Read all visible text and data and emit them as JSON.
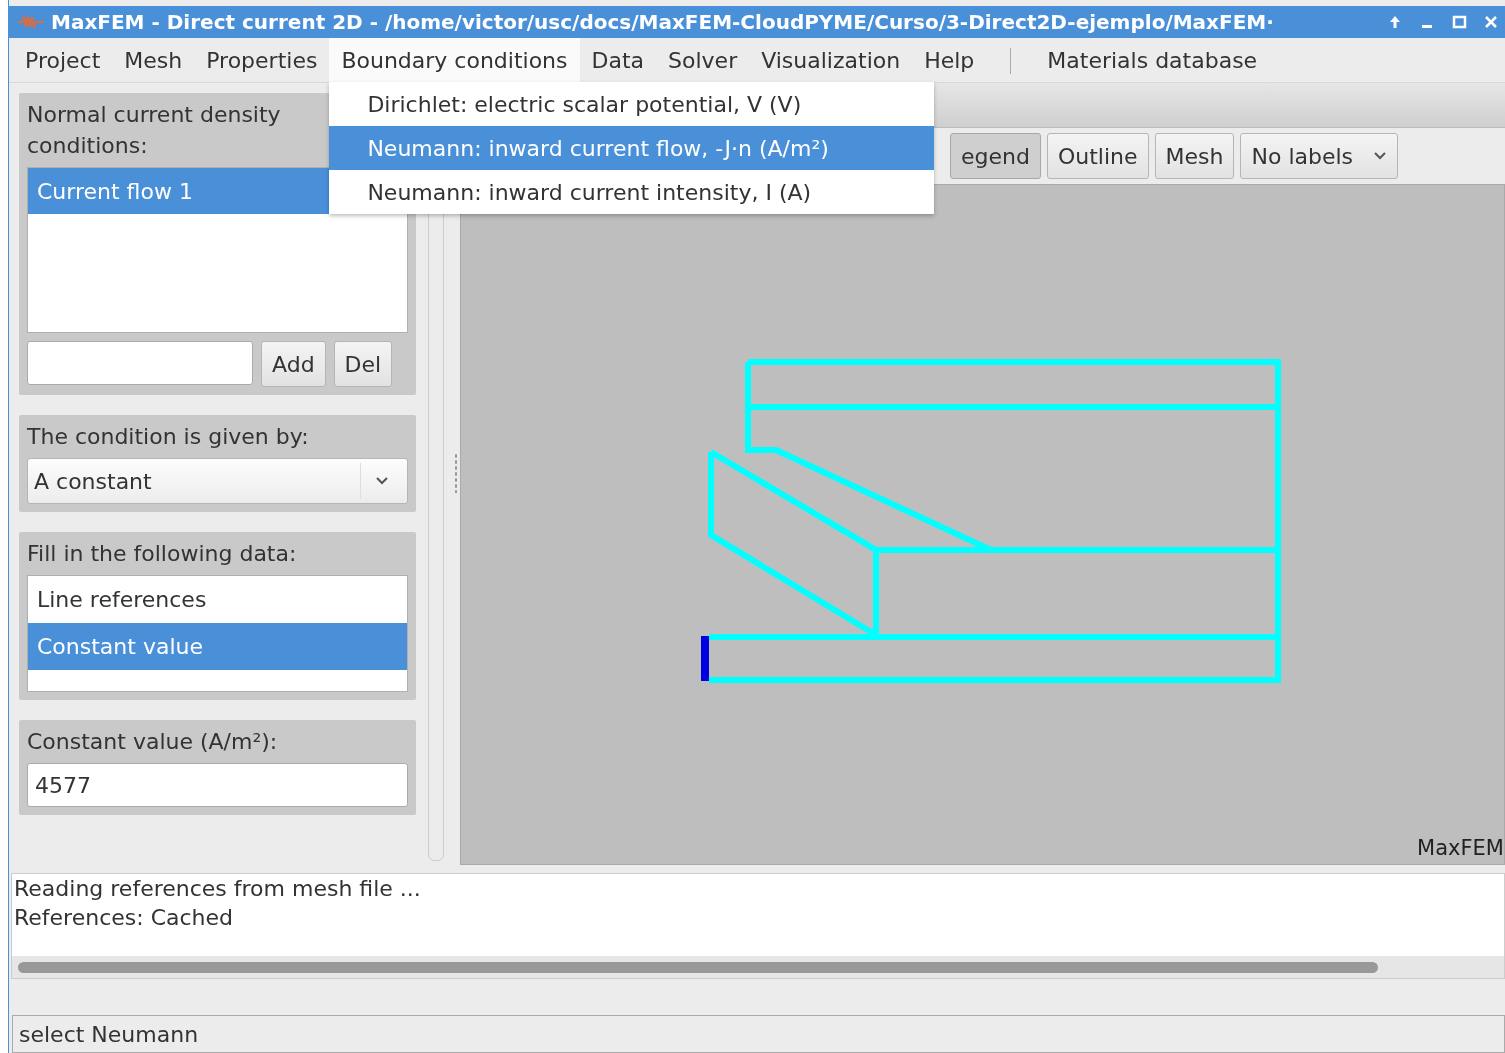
{
  "window": {
    "title": "MaxFEM - Direct current 2D - /home/victor/usc/docs/MaxFEM-CloudPYME/Curso/3-Direct2D-ejemplo/MaxFEM·"
  },
  "menu_bar": [
    {
      "label": "Project",
      "selected": false
    },
    {
      "label": "Mesh",
      "selected": false
    },
    {
      "label": "Properties",
      "selected": false
    },
    {
      "label": "Boundary conditions",
      "selected": true
    },
    {
      "label": "Data",
      "selected": false
    },
    {
      "label": "Solver",
      "selected": false
    },
    {
      "label": "Visualization",
      "selected": false
    },
    {
      "label": "Help",
      "selected": false
    },
    {
      "label": "Materials database",
      "selected": false,
      "separator_before": true
    }
  ],
  "open_menu": {
    "items": [
      {
        "label": "Dirichlet: electric scalar potential, V (V)",
        "selected": false
      },
      {
        "label": "Neumann: inward current flow, -J·n (A/m²)",
        "selected": true
      },
      {
        "label": "Neumann: inward current intensity, I (A)",
        "selected": false
      }
    ]
  },
  "conditions_panel": {
    "title": "Normal current density conditions:",
    "items": [
      {
        "label": "Current flow 1",
        "selected": true
      }
    ],
    "buttons": [
      "Add",
      "Del"
    ]
  },
  "condition_source": {
    "label": "The condition is given by:",
    "value": "A constant"
  },
  "data_panel": {
    "label": "Fill in the following data:",
    "items": [
      {
        "label": "Line references",
        "selected": false
      },
      {
        "label": "Constant value",
        "selected": true
      }
    ]
  },
  "value_panel": {
    "label": "Constant value (A/m²):",
    "value": "4577"
  },
  "view_toolbar": {
    "buttons": [
      {
        "label": "egend",
        "pressed": true
      },
      {
        "label": "Outline",
        "pressed": false
      },
      {
        "label": "Mesh",
        "pressed": false
      }
    ],
    "labels_dropdown": "No labels"
  },
  "canvas": {
    "watermark": "MaxFEM"
  },
  "log": {
    "lines": [
      "Reading references from mesh file ...",
      "References: Cached"
    ]
  },
  "status": "select Neumann"
}
